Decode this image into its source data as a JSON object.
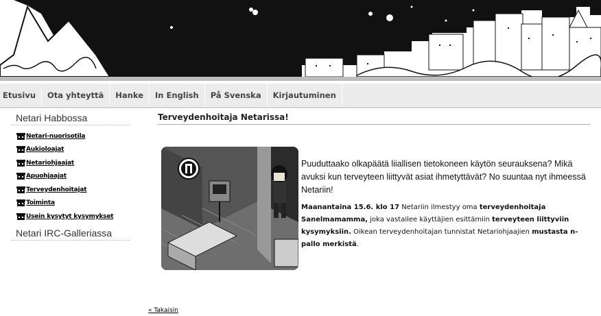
{
  "nav": {
    "items": [
      "Etusivu",
      "Ota yhteyttä",
      "Hanke",
      "In English",
      "På Svenska",
      "Kirjautuminen"
    ]
  },
  "sidebar": {
    "heading_habbo": "Netari Habbossa",
    "links": [
      "Netari-nuorisotila",
      "Aukioloajat",
      "Netariohjaajat",
      "Apuohjaajat",
      "Terveydenhoitajat",
      "Toiminta",
      "Usein kysytyt kysymykset"
    ],
    "heading_irc": "Netari IRC-Galleriassa"
  },
  "main": {
    "title": "Terveydenhoitaja Netarissa!",
    "intro": "Puuduttaako olkapäätä liiallisen tietokoneen käytön seurauksena? Mikä avuksi kun terveyteen liittyvät asiat ihmetyttävät? No suuntaa nyt ihmeessä Netariin!",
    "detail": {
      "p1_bold": "Maanantaina 15.6. klo 17",
      "p1_text": " Netariin ilmestyy oma ",
      "p1_bold2": "terveydenhoitaja Sanelmamamma,",
      "p1_text2": " joka vastailee käyttäjien esittämiin ",
      "p1_bold3": "terveyteen liittyviin kysymyksiin.",
      "p1_text3": " Oikean terveydenhoitajan tunnistat Netariohjaajien ",
      "p1_bold4": "mustasta n-pallo merkistä",
      "p1_end": "."
    },
    "back": "« Takaisin"
  }
}
